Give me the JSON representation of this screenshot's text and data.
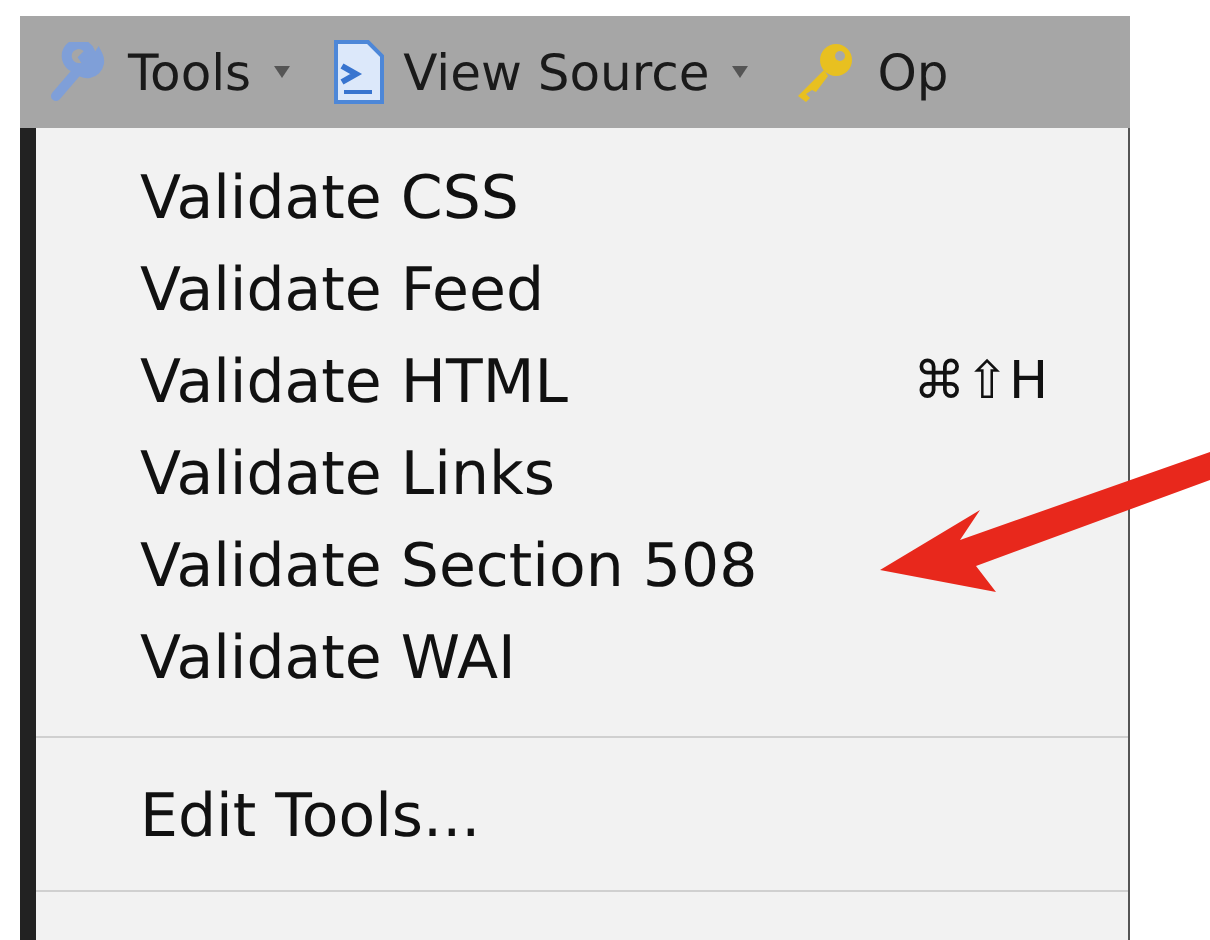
{
  "toolbar": [
    {
      "kind": "wrench",
      "label": "Tools",
      "dropdown": true
    },
    {
      "kind": "page",
      "label": "View Source",
      "dropdown": true
    },
    {
      "kind": "key",
      "label": "Op",
      "dropdown": false
    }
  ],
  "menu": [
    {
      "kind": "item",
      "label": "Validate CSS"
    },
    {
      "kind": "item",
      "label": "Validate Feed"
    },
    {
      "kind": "item",
      "label": "Validate HTML",
      "shortcut": "⌘⇧H"
    },
    {
      "kind": "item",
      "label": "Validate Links"
    },
    {
      "kind": "item",
      "label": "Validate Section 508"
    },
    {
      "kind": "item",
      "label": "Validate WAI"
    },
    {
      "kind": "separator"
    },
    {
      "kind": "item",
      "label": "Edit Tools..."
    },
    {
      "kind": "separator"
    }
  ],
  "annotation": {
    "kind": "arrow"
  }
}
